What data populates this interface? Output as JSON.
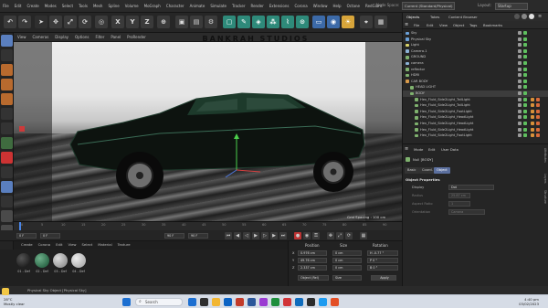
{
  "menubar": {
    "items": [
      "File",
      "Edit",
      "Create",
      "Modes",
      "Select",
      "Tools",
      "Mesh",
      "Spline",
      "Volume",
      "MoGraph",
      "Character",
      "Animate",
      "Simulate",
      "Tracker",
      "Render",
      "Extensions",
      "Corona",
      "Window",
      "Help",
      "Octane",
      "RedGiant"
    ],
    "node_space_label": "Node Space:",
    "node_space_value": "Current (Standard/Physical)",
    "layout_label": "Layout:",
    "layout_value": "Startup"
  },
  "toolbar": {
    "axis_buttons": [
      "X",
      "Y",
      "Z"
    ]
  },
  "viewport": {
    "menu": [
      "View",
      "Cameras",
      "Display",
      "Options",
      "Filter",
      "Panel",
      "ProRender"
    ],
    "brand_text": "BANKRAH STUDIOS",
    "grid_spacing": "Grid Spacing : 100 cm"
  },
  "timeline": {
    "ticks": [
      "0",
      "5",
      "10",
      "15",
      "20",
      "25",
      "30",
      "35",
      "40",
      "45",
      "50",
      "55",
      "60",
      "65",
      "70",
      "75",
      "80",
      "85",
      "90"
    ],
    "start_frame": "0 F",
    "current_frame": "0 F",
    "end_frame": "90 F",
    "end_frame_2": "90 F"
  },
  "materials": {
    "menu": [
      "Create",
      "Corona",
      "Edit",
      "View",
      "Select",
      "Material",
      "Texture"
    ],
    "items": [
      {
        "label": "01 - Def",
        "color": "#1f1f1f"
      },
      {
        "label": "02 - Def",
        "color": "#2f6b4b"
      },
      {
        "label": "03 - Def",
        "color": "#9a9a9a"
      },
      {
        "label": "04 - Def",
        "color": "#b3b3b3"
      },
      {
        "label": "05 - Def",
        "color": "#d0d0d0"
      }
    ]
  },
  "coordinates": {
    "headers": [
      "Position",
      "Size",
      "Rotation"
    ],
    "rows": [
      {
        "axis": "X",
        "pos": "0.976 cm",
        "size": "0 cm",
        "rot": "H  -0.77 °"
      },
      {
        "axis": "Y",
        "pos": "49.76 cm",
        "size": "0 cm",
        "rot": "P  0 °"
      },
      {
        "axis": "Z",
        "pos": "2.337 cm",
        "size": "0 cm",
        "rot": "B  0 °"
      }
    ],
    "mode_object": "Object (Rel)",
    "mode_size": "Size",
    "apply": "Apply"
  },
  "object_manager": {
    "tabs": [
      "Objects",
      "Takes",
      "Content Browser"
    ],
    "menu": [
      "File",
      "Edit",
      "View",
      "Object",
      "Tags",
      "Bookmarks"
    ],
    "items": [
      {
        "name": "Sky",
        "indent": 0,
        "color": "#6aa0d8"
      },
      {
        "name": "Physical Sky",
        "indent": 0,
        "color": "#6aa0d8"
      },
      {
        "name": "Light",
        "indent": 0,
        "color": "#d8d36a"
      },
      {
        "name": "Camera.1",
        "indent": 0,
        "color": "#8cb2d6"
      },
      {
        "name": "GROUND",
        "indent": 0,
        "color": "#7fb26e"
      },
      {
        "name": "camera",
        "indent": 0,
        "color": "#8cb2d6"
      },
      {
        "name": "reflector",
        "indent": 0,
        "color": "#7fb26e"
      },
      {
        "name": "HDRI",
        "indent": 0,
        "color": "#7fb26e"
      },
      {
        "name": "CAR BODY",
        "indent": 0,
        "color": "#d89a4a"
      },
      {
        "name": "HEAD LIGHT",
        "indent": 1,
        "color": "#7fb26e"
      },
      {
        "name": "BODY",
        "indent": 1,
        "color": "#7fb26e"
      },
      {
        "name": "Hex_Fluid_Side2Light_TailLight",
        "indent": 2,
        "color": "#7fb26e"
      },
      {
        "name": "Hex_Fluid_Side2Light_TailLight",
        "indent": 2,
        "color": "#7fb26e"
      },
      {
        "name": "Hex_Fluid_Side2Light_FootLight",
        "indent": 2,
        "color": "#7fb26e"
      },
      {
        "name": "Hex_Fluid_Side2Light_HeadLight",
        "indent": 2,
        "color": "#7fb26e"
      },
      {
        "name": "Hex_Fluid_Side2Light_HeadLight",
        "indent": 2,
        "color": "#7fb26e"
      },
      {
        "name": "Hex_Fluid_Side2Light_HeadLight",
        "indent": 2,
        "color": "#7fb26e"
      },
      {
        "name": "Hex_Fluid_Side2Light_FootLight",
        "indent": 2,
        "color": "#7fb26e"
      }
    ]
  },
  "attribute_manager": {
    "menu": [
      "Mode",
      "Edit",
      "User Data"
    ],
    "object_name": "Null [BODY]",
    "tabs": [
      "Basic",
      "Coord.",
      "Object"
    ],
    "active_tab": "Object",
    "section": "Object Properties",
    "fields": [
      {
        "label": "Display",
        "value": "Dot"
      },
      {
        "label": "Radius",
        "value": "25.87 cm"
      },
      {
        "label": "Aspect Ratio",
        "value": "1"
      },
      {
        "label": "Orientation",
        "value": "Camera"
      }
    ],
    "side_tabs": [
      "Attributes",
      "Layers",
      "Structure"
    ]
  },
  "status": {
    "text": "Physical Sky Object [Physical Sky]"
  },
  "taskbar": {
    "weather_temp": "28°C",
    "weather_desc": "Mostly clear",
    "search_placeholder": "Search",
    "time": "4:40 pm",
    "date": "03/02/2023",
    "icon_colors": [
      "#1c6fd1",
      "#2e2e2e",
      "#f2b632",
      "#0b63c4",
      "#c23b2a",
      "#2b579a",
      "#9b3bd2",
      "#1e8f3d",
      "#d13438",
      "#0f6cbd",
      "#2c2c2c",
      "#1d9bf0",
      "#e34f26"
    ]
  }
}
